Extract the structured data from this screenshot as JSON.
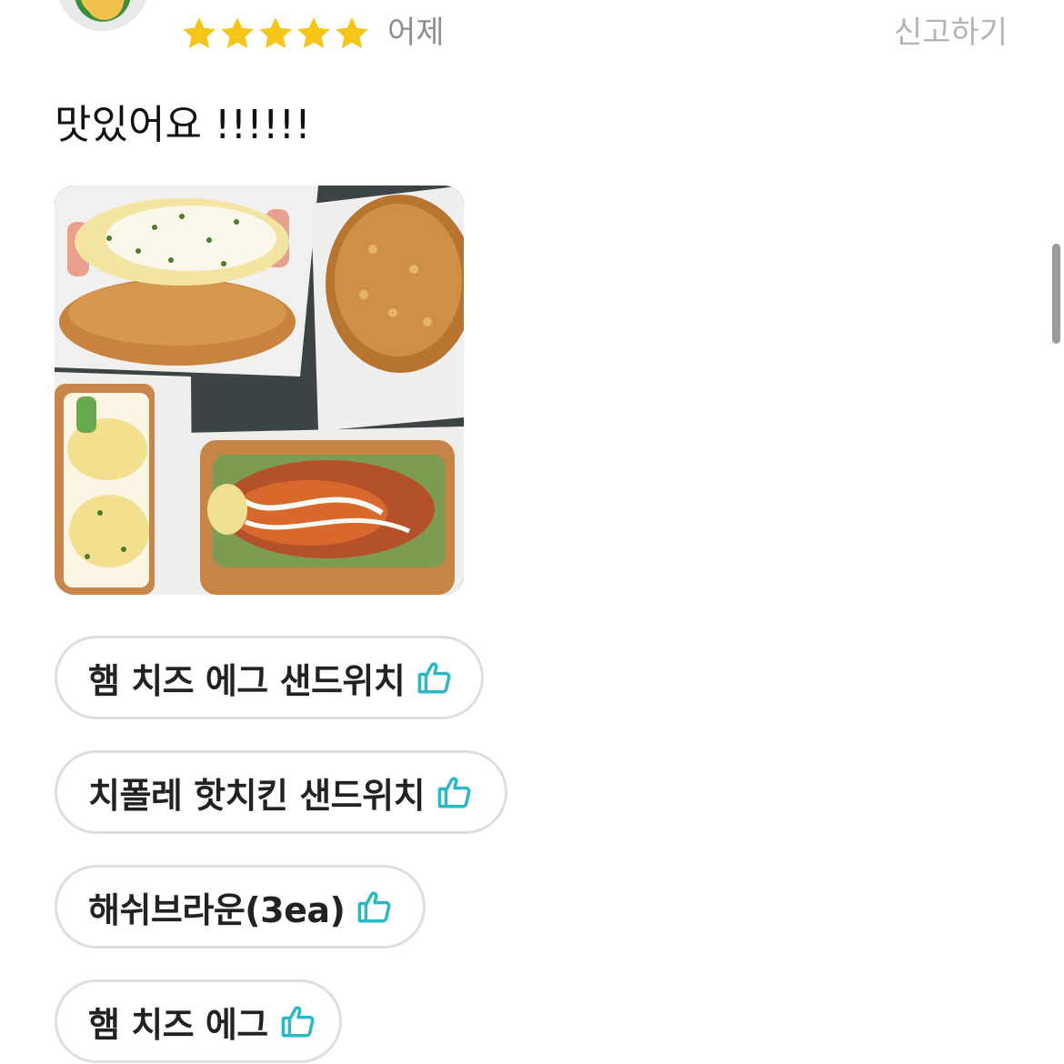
{
  "review": {
    "rating": 5,
    "rating_max": 5,
    "star_color": "#F5C518",
    "date": "어제",
    "report_label": "신고하기",
    "text": "맛있어요 !!!!!!",
    "photo": {
      "content": "sandwich-and-hashbrown-photo"
    }
  },
  "tags": [
    {
      "label": "햄 치즈 에그 샌드위치",
      "icon": "thumbs-up-icon"
    },
    {
      "label": "치폴레 핫치킨 샌드위치",
      "icon": "thumbs-up-icon"
    },
    {
      "label": "해쉬브라운(3ea)",
      "icon": "thumbs-up-icon"
    },
    {
      "label": "햄 치즈 에그",
      "icon": "thumbs-up-icon"
    }
  ],
  "colors": {
    "accent": "#2BB8C4",
    "tag_border": "#DEDEDE",
    "muted_text": "#8E8E8E",
    "report_text": "#B4B4B4"
  }
}
